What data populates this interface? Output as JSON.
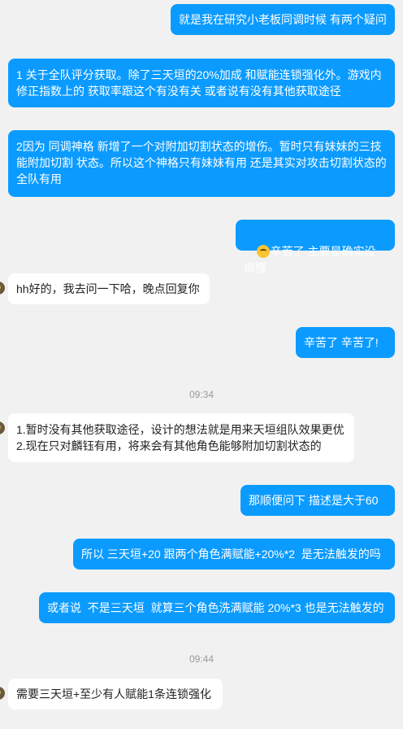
{
  "messages": [
    {
      "side": "out",
      "text": "就是我在研究小老板同调时候 有两个疑问"
    },
    {
      "side": "out",
      "text": "1 关于全队评分获取。除了三天垣的20%加成 和赋能连锁强化外。游戏内修正指数上的 获取率跟这个有没有关 或者说有没有其他获取途径"
    },
    {
      "side": "out",
      "text": "2因为 同调神格 新增了一个对附加切割状态的增伤。暂时只有妹妹的三技能附加切割 状态。所以这个神格只有妹妹有用 还是其实对攻击切割状态的全队有用"
    },
    {
      "side": "out",
      "emoji": "laughing-crying-emoji",
      "text": "辛苦了 主要是确实没搞懂"
    },
    {
      "side": "in",
      "text": "hh好的，我去问一下哈，晚点回复你"
    },
    {
      "side": "out",
      "text": "辛苦了 辛苦了!"
    },
    {
      "time": "09:34"
    },
    {
      "side": "in",
      "text": "1.暂时没有其他获取途径，设计的想法就是用来天垣组队效果更优\n2.现在只对麟钰有用，将来会有其他角色能够附加切割状态的"
    },
    {
      "side": "out",
      "text": "那顺便问下 描述是大于60"
    },
    {
      "side": "out",
      "text": "所以 三天垣+20 跟两个角色满赋能+20%*2  是无法触发的吗"
    },
    {
      "side": "out",
      "text": "或者说  不是三天垣  就算三个角色洗满赋能 20%*3 也是无法触发的"
    },
    {
      "time": "09:44"
    },
    {
      "side": "in",
      "text": "需要三天垣+至少有人赋能1条连锁强化"
    }
  ],
  "colors": {
    "background": "#f1f1f1",
    "outgoing_bubble": "#0b9bff",
    "incoming_bubble": "#ffffff",
    "timestamp_text": "#9a9a9a"
  }
}
